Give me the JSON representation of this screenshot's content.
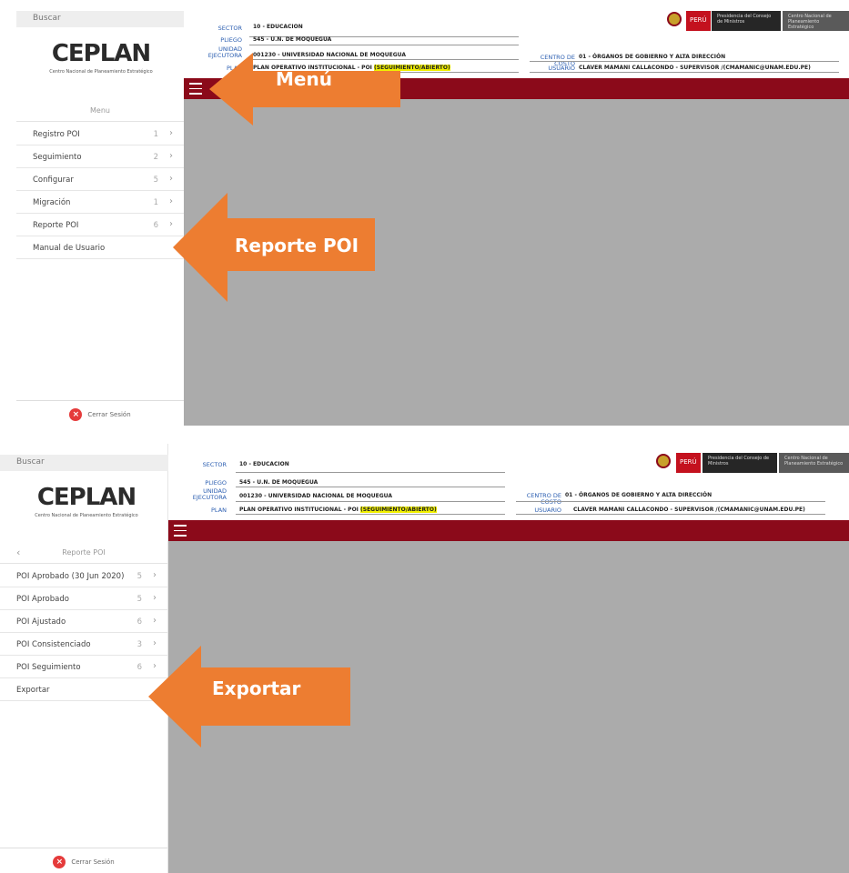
{
  "search_placeholder": "Buscar",
  "logo": {
    "word": "CEPLAN",
    "sub": "Centro Nacional de Planeamiento Estratégico"
  },
  "header": {
    "sector_label": "SECTOR",
    "sector": "10 - EDUCACION",
    "pliego_label": "PLIEGO",
    "pliego": "545 - U.N. DE MOQUEGUA",
    "unidad_label": "UNIDAD EJECUTORA",
    "unidad": "001230 - UNIVERSIDAD NACIONAL DE MOQUEGUA",
    "plan_label": "PLAN",
    "plan": "PLAN OPERATIVO INSTITUCIONAL - POI ",
    "plan_status": "(SEGUIMIENTO/ABIERTO)",
    "costo_label": "CENTRO DE COSTO",
    "costo": "01 - ÓRGANOS DE GOBIERNO Y ALTA DIRECCIÓN",
    "usuario_label": "USUARIO",
    "usuario": "CLAVER MAMANI CALLACONDO - SUPERVISOR /(CMAMANIC@UNAM.EDU.PE)"
  },
  "branding": {
    "peru": "PERÚ",
    "pcm": "Presidencia del Consejo de Ministros",
    "ceplan": "Centro Nacional de Planeamiento Estratégico"
  },
  "panel1": {
    "menu_title": "Menu",
    "items": [
      {
        "label": "Registro POI",
        "count": "1"
      },
      {
        "label": "Seguimiento",
        "count": "2"
      },
      {
        "label": "Configurar",
        "count": "5"
      },
      {
        "label": "Migración",
        "count": "1"
      },
      {
        "label": "Reporte POI",
        "count": "6"
      },
      {
        "label": "Manual de Usuario",
        "count": ""
      }
    ],
    "arrow_menu": "Menú",
    "arrow_reporte": "Reporte POI"
  },
  "panel2": {
    "menu_title": "Reporte POI",
    "items": [
      {
        "label": "POI Aprobado (30 Jun 2020)",
        "count": "5"
      },
      {
        "label": "POI Aprobado",
        "count": "5"
      },
      {
        "label": "POI Ajustado",
        "count": "6"
      },
      {
        "label": "POI Consistenciado",
        "count": "3"
      },
      {
        "label": "POI Seguimiento",
        "count": "6"
      },
      {
        "label": "Exportar",
        "count": ""
      }
    ],
    "arrow_exportar": "Exportar"
  },
  "logout_label": "Cerrar Sesión",
  "colors": {
    "arrow": "#ed7d31",
    "bar": "#8b0a1a",
    "main_bg": "#ababab"
  }
}
